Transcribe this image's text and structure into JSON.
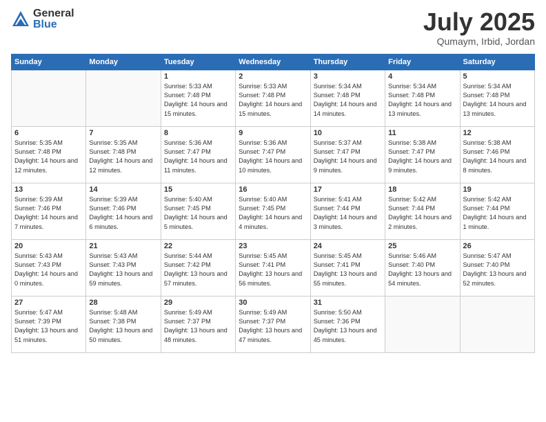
{
  "header": {
    "logo_general": "General",
    "logo_blue": "Blue",
    "month_title": "July 2025",
    "location": "Qumaym, Irbid, Jordan"
  },
  "weekdays": [
    "Sunday",
    "Monday",
    "Tuesday",
    "Wednesday",
    "Thursday",
    "Friday",
    "Saturday"
  ],
  "weeks": [
    [
      {
        "day": "",
        "empty": true
      },
      {
        "day": "",
        "empty": true
      },
      {
        "day": "1",
        "sunrise": "Sunrise: 5:33 AM",
        "sunset": "Sunset: 7:48 PM",
        "daylight": "Daylight: 14 hours and 15 minutes."
      },
      {
        "day": "2",
        "sunrise": "Sunrise: 5:33 AM",
        "sunset": "Sunset: 7:48 PM",
        "daylight": "Daylight: 14 hours and 15 minutes."
      },
      {
        "day": "3",
        "sunrise": "Sunrise: 5:34 AM",
        "sunset": "Sunset: 7:48 PM",
        "daylight": "Daylight: 14 hours and 14 minutes."
      },
      {
        "day": "4",
        "sunrise": "Sunrise: 5:34 AM",
        "sunset": "Sunset: 7:48 PM",
        "daylight": "Daylight: 14 hours and 13 minutes."
      },
      {
        "day": "5",
        "sunrise": "Sunrise: 5:34 AM",
        "sunset": "Sunset: 7:48 PM",
        "daylight": "Daylight: 14 hours and 13 minutes."
      }
    ],
    [
      {
        "day": "6",
        "sunrise": "Sunrise: 5:35 AM",
        "sunset": "Sunset: 7:48 PM",
        "daylight": "Daylight: 14 hours and 12 minutes."
      },
      {
        "day": "7",
        "sunrise": "Sunrise: 5:35 AM",
        "sunset": "Sunset: 7:48 PM",
        "daylight": "Daylight: 14 hours and 12 minutes."
      },
      {
        "day": "8",
        "sunrise": "Sunrise: 5:36 AM",
        "sunset": "Sunset: 7:47 PM",
        "daylight": "Daylight: 14 hours and 11 minutes."
      },
      {
        "day": "9",
        "sunrise": "Sunrise: 5:36 AM",
        "sunset": "Sunset: 7:47 PM",
        "daylight": "Daylight: 14 hours and 10 minutes."
      },
      {
        "day": "10",
        "sunrise": "Sunrise: 5:37 AM",
        "sunset": "Sunset: 7:47 PM",
        "daylight": "Daylight: 14 hours and 9 minutes."
      },
      {
        "day": "11",
        "sunrise": "Sunrise: 5:38 AM",
        "sunset": "Sunset: 7:47 PM",
        "daylight": "Daylight: 14 hours and 9 minutes."
      },
      {
        "day": "12",
        "sunrise": "Sunrise: 5:38 AM",
        "sunset": "Sunset: 7:46 PM",
        "daylight": "Daylight: 14 hours and 8 minutes."
      }
    ],
    [
      {
        "day": "13",
        "sunrise": "Sunrise: 5:39 AM",
        "sunset": "Sunset: 7:46 PM",
        "daylight": "Daylight: 14 hours and 7 minutes."
      },
      {
        "day": "14",
        "sunrise": "Sunrise: 5:39 AM",
        "sunset": "Sunset: 7:46 PM",
        "daylight": "Daylight: 14 hours and 6 minutes."
      },
      {
        "day": "15",
        "sunrise": "Sunrise: 5:40 AM",
        "sunset": "Sunset: 7:45 PM",
        "daylight": "Daylight: 14 hours and 5 minutes."
      },
      {
        "day": "16",
        "sunrise": "Sunrise: 5:40 AM",
        "sunset": "Sunset: 7:45 PM",
        "daylight": "Daylight: 14 hours and 4 minutes."
      },
      {
        "day": "17",
        "sunrise": "Sunrise: 5:41 AM",
        "sunset": "Sunset: 7:44 PM",
        "daylight": "Daylight: 14 hours and 3 minutes."
      },
      {
        "day": "18",
        "sunrise": "Sunrise: 5:42 AM",
        "sunset": "Sunset: 7:44 PM",
        "daylight": "Daylight: 14 hours and 2 minutes."
      },
      {
        "day": "19",
        "sunrise": "Sunrise: 5:42 AM",
        "sunset": "Sunset: 7:44 PM",
        "daylight": "Daylight: 14 hours and 1 minute."
      }
    ],
    [
      {
        "day": "20",
        "sunrise": "Sunrise: 5:43 AM",
        "sunset": "Sunset: 7:43 PM",
        "daylight": "Daylight: 14 hours and 0 minutes."
      },
      {
        "day": "21",
        "sunrise": "Sunrise: 5:43 AM",
        "sunset": "Sunset: 7:43 PM",
        "daylight": "Daylight: 13 hours and 59 minutes."
      },
      {
        "day": "22",
        "sunrise": "Sunrise: 5:44 AM",
        "sunset": "Sunset: 7:42 PM",
        "daylight": "Daylight: 13 hours and 57 minutes."
      },
      {
        "day": "23",
        "sunrise": "Sunrise: 5:45 AM",
        "sunset": "Sunset: 7:41 PM",
        "daylight": "Daylight: 13 hours and 56 minutes."
      },
      {
        "day": "24",
        "sunrise": "Sunrise: 5:45 AM",
        "sunset": "Sunset: 7:41 PM",
        "daylight": "Daylight: 13 hours and 55 minutes."
      },
      {
        "day": "25",
        "sunrise": "Sunrise: 5:46 AM",
        "sunset": "Sunset: 7:40 PM",
        "daylight": "Daylight: 13 hours and 54 minutes."
      },
      {
        "day": "26",
        "sunrise": "Sunrise: 5:47 AM",
        "sunset": "Sunset: 7:40 PM",
        "daylight": "Daylight: 13 hours and 52 minutes."
      }
    ],
    [
      {
        "day": "27",
        "sunrise": "Sunrise: 5:47 AM",
        "sunset": "Sunset: 7:39 PM",
        "daylight": "Daylight: 13 hours and 51 minutes."
      },
      {
        "day": "28",
        "sunrise": "Sunrise: 5:48 AM",
        "sunset": "Sunset: 7:38 PM",
        "daylight": "Daylight: 13 hours and 50 minutes."
      },
      {
        "day": "29",
        "sunrise": "Sunrise: 5:49 AM",
        "sunset": "Sunset: 7:37 PM",
        "daylight": "Daylight: 13 hours and 48 minutes."
      },
      {
        "day": "30",
        "sunrise": "Sunrise: 5:49 AM",
        "sunset": "Sunset: 7:37 PM",
        "daylight": "Daylight: 13 hours and 47 minutes."
      },
      {
        "day": "31",
        "sunrise": "Sunrise: 5:50 AM",
        "sunset": "Sunset: 7:36 PM",
        "daylight": "Daylight: 13 hours and 45 minutes."
      },
      {
        "day": "",
        "empty": true
      },
      {
        "day": "",
        "empty": true
      }
    ]
  ]
}
